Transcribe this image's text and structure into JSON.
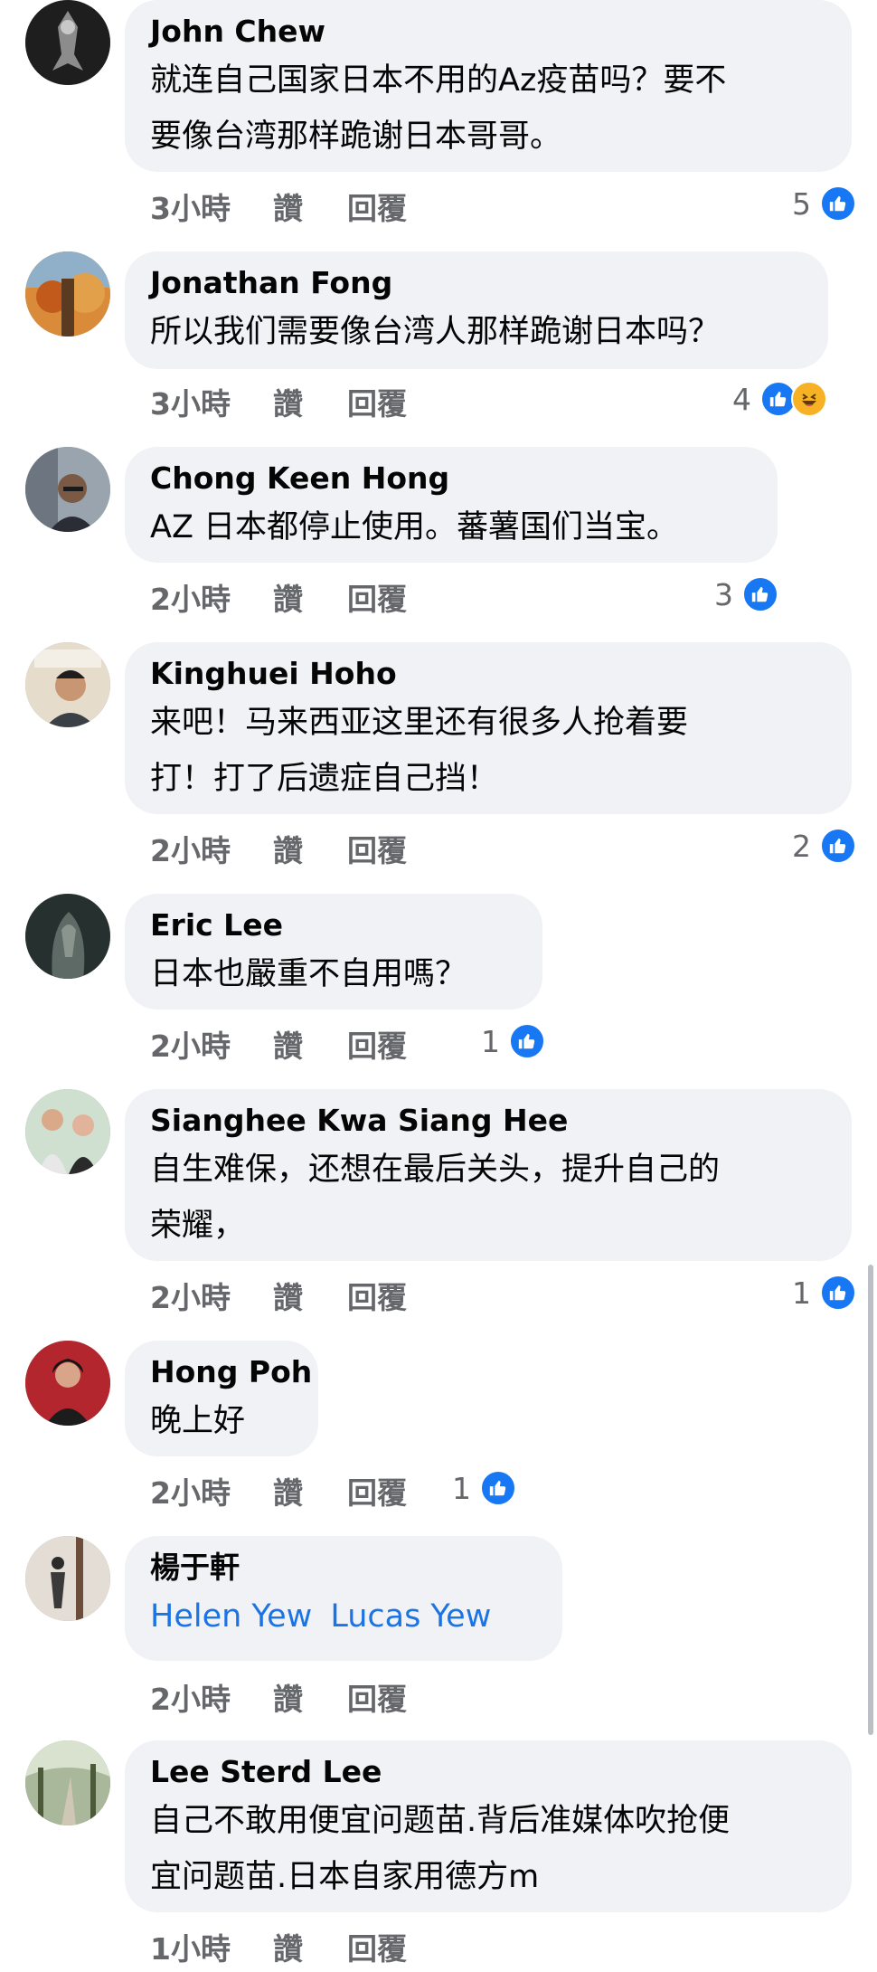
{
  "comments": [
    {
      "name": "John Chew",
      "text_lines": [
        "就连自己国家日本不用的Az疫苗吗？要不",
        "要像台湾那样跪谢日本哥哥。"
      ],
      "time": "3小時",
      "like_label": "讚",
      "reply_label": "回覆",
      "reaction_count": "5",
      "reactions": [
        "like-icon"
      ],
      "avatar_color": "#2b2b2b"
    },
    {
      "name": "Jonathan Fong",
      "text_lines": [
        "所以我们需要像台湾人那样跪谢日本吗？"
      ],
      "time": "3小時",
      "like_label": "讚",
      "reply_label": "回覆",
      "reaction_count": "4",
      "reactions": [
        "like-icon",
        "haha-icon"
      ],
      "avatar_color": "#b86b2a"
    },
    {
      "name": "Chong Keen Hong",
      "text_lines": [
        "AZ 日本都停止使用。蕃薯国们当宝。"
      ],
      "time": "2小時",
      "like_label": "讚",
      "reply_label": "回覆",
      "reaction_count": "3",
      "reactions": [
        "like-icon"
      ],
      "avatar_color": "#5b6470"
    },
    {
      "name": "Kinghuei Hoho",
      "text_lines": [
        "来吧！马来西亚这里还有很多人抢着要",
        "打！打了后遗症自己挡！"
      ],
      "time": "2小時",
      "like_label": "讚",
      "reply_label": "回覆",
      "reaction_count": "2",
      "reactions": [
        "like-icon"
      ],
      "avatar_color": "#c9b79a"
    },
    {
      "name": "Eric Lee",
      "text_lines": [
        "日本也嚴重不自用嗎？"
      ],
      "time": "2小時",
      "like_label": "讚",
      "reply_label": "回覆",
      "reaction_count": "1",
      "reactions": [
        "like-icon"
      ],
      "avatar_color": "#3c4a4c"
    },
    {
      "name": "Sianghee Kwa Siang Hee",
      "text_lines": [
        "自生难保，还想在最后关头，提升自己的",
        "荣耀，"
      ],
      "time": "2小時",
      "like_label": "讚",
      "reply_label": "回覆",
      "reaction_count": "1",
      "reactions": [
        "like-icon"
      ],
      "avatar_color": "#8fa38a"
    },
    {
      "name": "Hong Poh",
      "text_lines": [
        "晚上好"
      ],
      "time": "2小時",
      "like_label": "讚",
      "reply_label": "回覆",
      "reaction_count": "1",
      "reactions": [
        "like-icon"
      ],
      "avatar_color": "#b3262d"
    },
    {
      "name": "楊于軒",
      "mentions": [
        "Helen Yew",
        "Lucas Yew"
      ],
      "time": "2小時",
      "like_label": "讚",
      "reply_label": "回覆",
      "reaction_count": "",
      "reactions": [],
      "avatar_color": "#d8d2cc"
    },
    {
      "name": "Lee Sterd Lee",
      "text_lines": [
        "自己不敢用便宜问题苗.背后准媒体吹抢便",
        "宜问题苗.日本自家用德方m"
      ],
      "time": "1小時",
      "like_label": "讚",
      "reply_label": "回覆",
      "reaction_count": "",
      "reactions": [],
      "avatar_color": "#7d8a6a"
    }
  ],
  "colors": {
    "bubble_bg": "#f0f2f5",
    "meta_text": "#65676b",
    "like_blue": "#1877f2",
    "mention_blue": "#1b74e4",
    "haha_yellow": "#f7b125"
  }
}
